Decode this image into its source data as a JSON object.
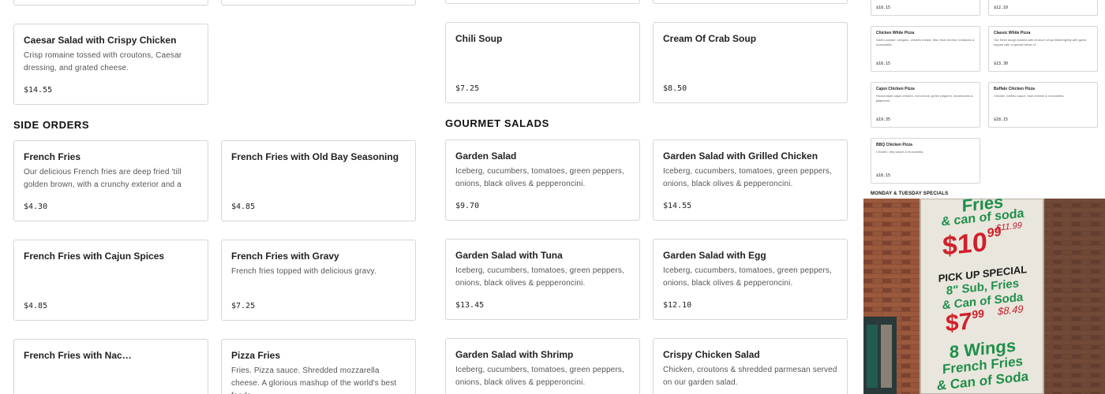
{
  "top_partial_cards": [
    "",
    "",
    "",
    ""
  ],
  "caesar": {
    "title": "Caesar Salad with Crispy Chicken",
    "desc": "Crisp romaine tossed with croutons, Caesar dressing, and grated cheese.",
    "price": "$14.55"
  },
  "soups": [
    {
      "title": "Chili Soup",
      "price": "$7.25"
    },
    {
      "title": "Cream Of Crab Soup",
      "price": "$8.50"
    }
  ],
  "side_orders": {
    "heading": "SIDE ORDERS",
    "items": [
      {
        "title": "French Fries",
        "desc": "Our delicious French fries are deep fried 'till golden brown, with a crunchy exterior and a light…",
        "price": "$4.30"
      },
      {
        "title": "French Fries with Old Bay Seasoning",
        "desc": "",
        "price": "$4.85"
      },
      {
        "title": "French Fries with Cajun Spices",
        "desc": "",
        "price": "$4.85"
      },
      {
        "title": "French Fries with Gravy",
        "desc": "French fries topped with delicious gravy.",
        "price": "$7.25"
      },
      {
        "title": "French Fries with Nac…",
        "desc": "",
        "price": ""
      },
      {
        "title": "Pizza Fries",
        "desc": "Fries. Pizza sauce. Shredded mozzarella cheese. A glorious mashup of the world's best foods.",
        "price": ""
      }
    ]
  },
  "gourmet_salads": {
    "heading": "GOURMET SALADS",
    "items": [
      {
        "title": "Garden Salad",
        "desc": "Iceberg, cucumbers, tomatoes, green peppers, onions, black olives & pepperoncini.",
        "price": "$9.70"
      },
      {
        "title": "Garden Salad with Grilled Chicken",
        "desc": "Iceberg, cucumbers, tomatoes, green peppers, onions, black olives & pepperoncini.",
        "price": "$14.55"
      },
      {
        "title": "Garden Salad with Tuna",
        "desc": "Iceberg, cucumbers, tomatoes, green peppers, onions, black olives & pepperoncini.",
        "price": "$13.45"
      },
      {
        "title": "Garden Salad with Egg",
        "desc": "Iceberg, cucumbers, tomatoes, green peppers, onions, black olives & pepperoncini.",
        "price": "$12.10"
      },
      {
        "title": "Garden Salad with Shrimp",
        "desc": "Iceberg, cucumbers, tomatoes, green peppers, onions, black olives & pepperoncini.",
        "price": ""
      },
      {
        "title": "Crispy Chicken Salad",
        "desc": "Chicken, croutons & shredded parmesan served on our garden salad.",
        "price": ""
      }
    ]
  },
  "pizza_panel": {
    "top_prices": [
      "$18.15",
      "$12.10"
    ],
    "items": [
      {
        "title": "Chicken White Pizza",
        "desc": "Garlic powder, oregano, chicken breast, feta, blue cheese, tomatoes & mozzarella.",
        "price": "$18.15"
      },
      {
        "title": "Classic White Pizza",
        "desc": "Our fresh dough basted with at touch of sprinkled lightly with garlic topped with a special blend of…",
        "price": "$13.30"
      },
      {
        "title": "Cajun Chicken Pizza",
        "desc": "Housemade cajun chicken, red onions, green peppers, mushrooms & jalapenos.",
        "price": "$19.35"
      },
      {
        "title": "Buffalo Chicken Pizza",
        "desc": "Chicken, buffalo sauce, blue cheese & mozzarella.",
        "price": "$18.15"
      },
      {
        "title": "BBQ Chicken Pizza",
        "desc": "Chicken, bbq sauce & mozzarella.",
        "price": "$18.15"
      }
    ],
    "specials_heading": "MONDAY & TUESDAY SPECIALS"
  },
  "photo_sign": {
    "line1": "Fries",
    "line2": "& can of soda",
    "price1": "$10",
    "price1_cents": "99",
    "handwritten1": "$11.99",
    "line3": "PICK UP SPECIAL",
    "line4": "8\" Sub, Fries",
    "line5": "& Can of Soda",
    "price2": "$7",
    "price2_cents": "99",
    "handwritten2": "$8.49",
    "line6": "8 Wings",
    "line7": "French Fries",
    "line8": "& Can of Soda"
  }
}
